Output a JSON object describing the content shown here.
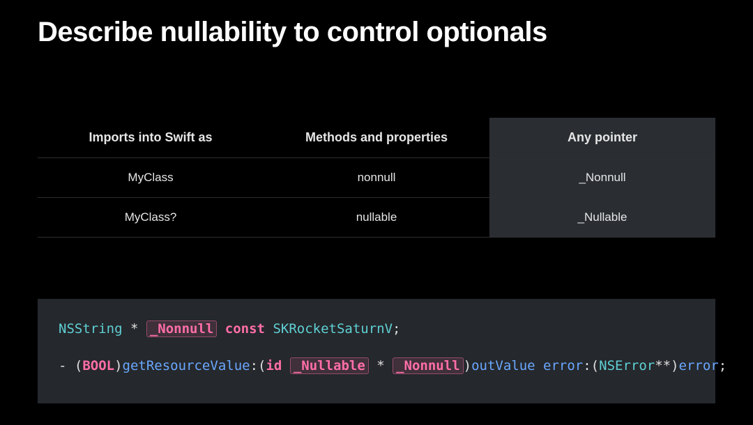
{
  "title": "Describe nullability to control optionals",
  "table": {
    "headers": [
      "Imports into Swift as",
      "Methods and properties",
      "Any pointer"
    ],
    "highlight_col": 2,
    "rows": [
      [
        "MyClass",
        "nonnull",
        "_Nonnull"
      ],
      [
        "MyClass?",
        "nullable",
        "_Nullable"
      ]
    ]
  },
  "code": {
    "line1": {
      "t1": "NSString",
      "star": " * ",
      "annot": "_Nonnull",
      "kw": " const ",
      "ident": "SKRocketSaturnV",
      "semi": ";"
    },
    "line2": {
      "dash": "- (",
      "bool": "BOOL",
      "close1": ")",
      "fn": "getResourceValue",
      "colon1": ":(",
      "id": "id",
      "sp1": " ",
      "annot1": "_Nullable",
      "star2": " * ",
      "annot2": "_Nonnull",
      "close2": ")",
      "out": "outValue",
      "sp2": " ",
      "err": "error",
      "colon2": ":(",
      "nserr": "NSError",
      "stars": "**)",
      "errp": "error",
      "semi": ";"
    }
  }
}
